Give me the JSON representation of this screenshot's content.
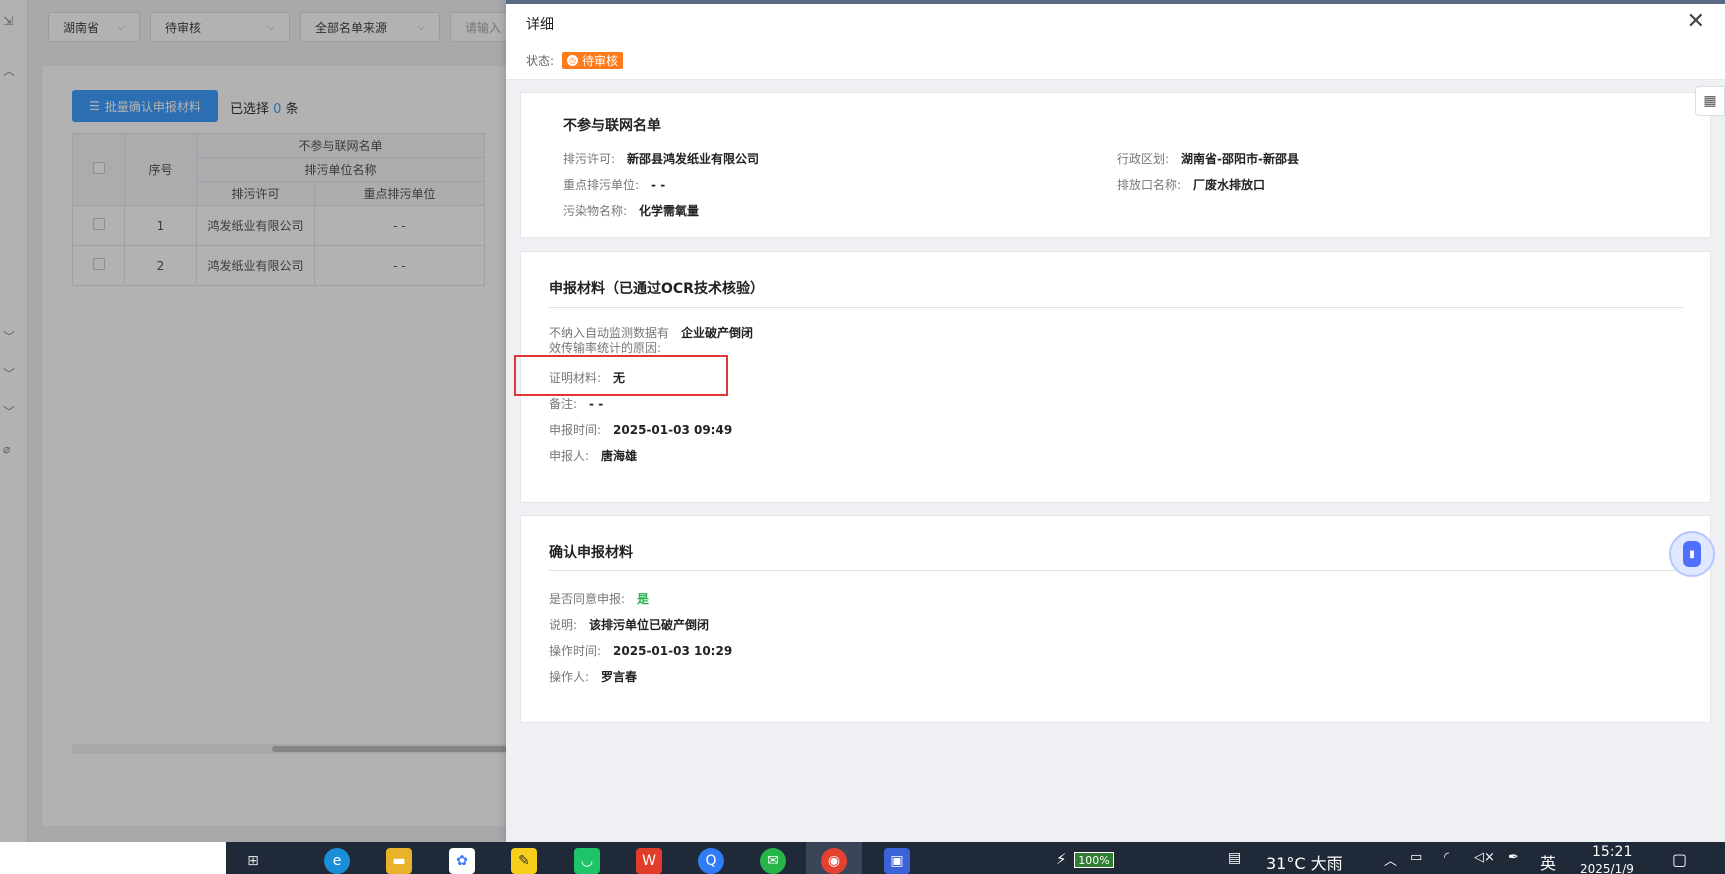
{
  "background": {
    "filters": [
      {
        "value": "湖南省"
      },
      {
        "value": "待审核"
      },
      {
        "value": "全部名单来源"
      },
      {
        "value": "请输入"
      }
    ],
    "batch_button": "批量确认申报材料",
    "selected_prefix": "已选择",
    "selected_count": "0",
    "selected_suffix": "条",
    "table": {
      "group_header": "不参与联网名单",
      "col_seq": "序号",
      "col_unit": "排污单位名称",
      "col_permit": "排污许可",
      "col_key": "重点排污单位",
      "rows": [
        {
          "seq": "1",
          "permit": "鸿发纸业有限公司",
          "key": "- -"
        },
        {
          "seq": "2",
          "permit": "鸿发纸业有限公司",
          "key": "- -"
        }
      ]
    }
  },
  "drawer": {
    "title": "详细",
    "status_label": "状态:",
    "status_value": "待审核",
    "section1": {
      "title": "不参与联网名单",
      "permit_label": "排污许可:",
      "permit_value": "新邵县鸿发纸业有限公司",
      "region_label": "行政区划:",
      "region_value": "湖南省-邵阳市-新邵县",
      "key_label": "重点排污单位:",
      "key_value": "- -",
      "outlet_label": "排放口名称:",
      "outlet_value": "厂废水排放口",
      "pollutant_label": "污染物名称:",
      "pollutant_value": "化学需氧量"
    },
    "section2": {
      "title": "申报材料（已通过OCR技术核验）",
      "reason_label_1": "不纳入自动监测数据有",
      "reason_label_2": "效传输率统计的原因:",
      "reason_value": "企业破产倒闭",
      "proof_label": "证明材料:",
      "proof_value": "无",
      "note_label": "备注:",
      "note_value": "- -",
      "time_label": "申报时间:",
      "time_value": "2025-01-03 09:49",
      "person_label": "申报人:",
      "person_value": "唐海雄"
    },
    "section3": {
      "title": "确认申报材料",
      "agree_label": "是否同意申报:",
      "agree_value": "是",
      "desc_label": "说明:",
      "desc_value": "该排污单位已破产倒闭",
      "optime_label": "操作时间:",
      "optime_value": "2025-01-03 10:29",
      "operator_label": "操作人:",
      "operator_value": "罗言春"
    }
  },
  "taskbar": {
    "battery": "100%",
    "weather": "31°C 大雨",
    "ime": "英",
    "time": "15:21",
    "date": "2025/1/9"
  },
  "colors": {
    "accent": "#409eff",
    "status_orange": "#ff7a1a",
    "agree_green": "#25b34a",
    "highlight_red": "#e03636"
  }
}
